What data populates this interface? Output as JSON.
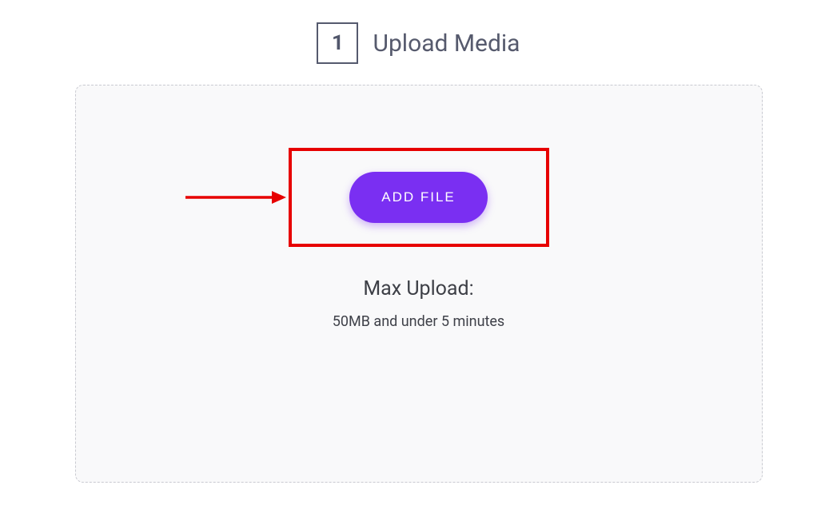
{
  "header": {
    "step_number": "1",
    "title": "Upload Media"
  },
  "dropzone": {
    "add_file_label": "ADD FILE",
    "max_upload_label": "Max Upload:",
    "max_upload_detail": "50MB and under 5 minutes"
  },
  "colors": {
    "accent": "#7a2ff2",
    "highlight": "#e70000"
  }
}
